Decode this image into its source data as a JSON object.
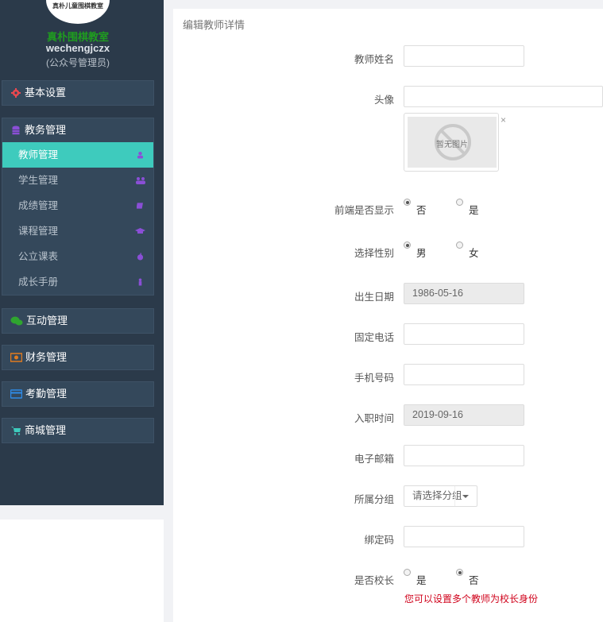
{
  "sidebar": {
    "logo_text": "真朴儿童围棋教室",
    "school_name": "真朴围棋教室",
    "account": "wechengjczx",
    "role": "(公众号管理员)",
    "groups": [
      {
        "label": "基本设置",
        "icon": "gear-icon",
        "color": "#e9484f"
      },
      {
        "label": "教务管理",
        "icon": "database-icon",
        "color": "#8a4fd6"
      },
      {
        "label": "互动管理",
        "icon": "wechat-icon",
        "color": "#2fa52f"
      },
      {
        "label": "财务管理",
        "icon": "money-icon",
        "color": "#e07b1f"
      },
      {
        "label": "考勤管理",
        "icon": "card-icon",
        "color": "#2e8ae6"
      },
      {
        "label": "商城管理",
        "icon": "cart-icon",
        "color": "#3ecbbd"
      }
    ],
    "edu_items": [
      {
        "label": "教师管理",
        "icon": "user-icon",
        "active": true
      },
      {
        "label": "学生管理",
        "icon": "users-icon",
        "active": false
      },
      {
        "label": "成绩管理",
        "icon": "book-icon",
        "active": false
      },
      {
        "label": "课程管理",
        "icon": "graduation-cap-icon",
        "active": false
      },
      {
        "label": "公立课表",
        "icon": "apple-icon",
        "active": false
      },
      {
        "label": "成长手册",
        "icon": "child-icon",
        "active": false
      }
    ]
  },
  "panel": {
    "title": "编辑教师详情",
    "avatar_placeholder": "暂无图片",
    "close_symbol": "×",
    "fields": {
      "name_label": "教师姓名",
      "name_value": "",
      "avatar_label": "头像",
      "avatar_value": "",
      "display_label": "前端是否显示",
      "display_no": "否",
      "display_yes": "是",
      "gender_label": "选择性别",
      "gender_male": "男",
      "gender_female": "女",
      "birth_label": "出生日期",
      "birth_value": "1986-05-16",
      "phone_label": "固定电话",
      "phone_value": "",
      "mobile_label": "手机号码",
      "mobile_value": "",
      "entry_label": "入职时间",
      "entry_value": "2019-09-16",
      "email_label": "电子邮箱",
      "email_value": "",
      "group_label": "所属分组",
      "group_value": "请选择分组",
      "bind_label": "绑定码",
      "bind_value": "",
      "principal_label": "是否校长",
      "principal_yes": "是",
      "principal_no": "否",
      "principal_hint": "您可以设置多个教师为校长身份"
    },
    "selected": {
      "display": "否",
      "gender": "男",
      "principal": "否"
    }
  }
}
